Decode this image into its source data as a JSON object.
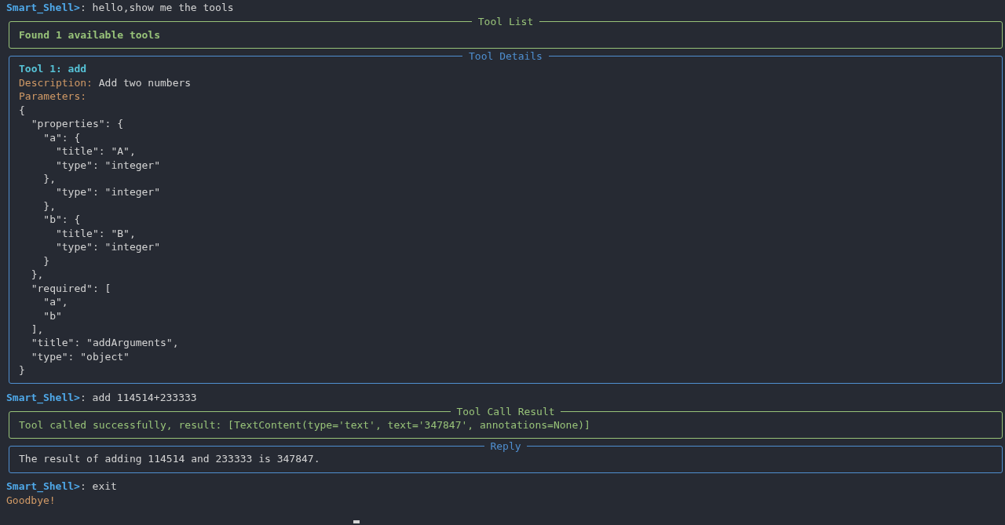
{
  "terminal": [
    {
      "kind": "prompt",
      "prompt": "Smart_Shell>",
      "separator": ":",
      "command": "hello,show me the tools"
    },
    {
      "kind": "panel",
      "title": "Tool List",
      "color": "#98c379",
      "lines": [
        {
          "kind": "success_bold",
          "text": "Found 1 available tools"
        }
      ]
    },
    {
      "kind": "panel",
      "title": "Tool Details",
      "color": "#4f8fd0",
      "lines": [
        {
          "kind": "heading",
          "text": "Tool 1: add"
        },
        {
          "kind": "field",
          "label": "Description:",
          "text": "Add two numbers"
        },
        {
          "kind": "label",
          "label": "Parameters:"
        },
        {
          "kind": "code",
          "text": "{"
        },
        {
          "kind": "code",
          "text": "  \"properties\": {"
        },
        {
          "kind": "code",
          "text": "    \"a\": {"
        },
        {
          "kind": "code",
          "text": "      \"title\": \"A\","
        },
        {
          "kind": "code",
          "text": "      \"type\": \"integer\""
        },
        {
          "kind": "code",
          "text": "    },"
        },
        {
          "kind": "code",
          "text": "      \"type\": \"integer\""
        },
        {
          "kind": "code",
          "text": "    },"
        },
        {
          "kind": "code",
          "text": "    \"b\": {"
        },
        {
          "kind": "code",
          "text": "      \"title\": \"B\","
        },
        {
          "kind": "code",
          "text": "      \"type\": \"integer\""
        },
        {
          "kind": "code",
          "text": "    }"
        },
        {
          "kind": "code",
          "text": "  },"
        },
        {
          "kind": "code",
          "text": "  \"required\": ["
        },
        {
          "kind": "code",
          "text": "    \"a\","
        },
        {
          "kind": "code",
          "text": "    \"b\""
        },
        {
          "kind": "code",
          "text": "  ],"
        },
        {
          "kind": "code",
          "text": "  \"title\": \"addArguments\","
        },
        {
          "kind": "code",
          "text": "  \"type\": \"object\""
        },
        {
          "kind": "code",
          "text": "}"
        }
      ]
    },
    {
      "kind": "prompt",
      "prompt": "Smart_Shell>",
      "separator": ":",
      "command": "add 114514+233333"
    },
    {
      "kind": "panel",
      "title": "Tool Call Result",
      "color": "#98c379",
      "lines": [
        {
          "kind": "success",
          "text": "Tool called successfully, result: [TextContent(type='text', text='347847', annotations=None)]"
        }
      ]
    },
    {
      "kind": "panel",
      "title": "Reply",
      "color": "#4f8fd0",
      "lines": [
        {
          "kind": "code",
          "text": "The result of adding 114514 and 233333 is 347847."
        }
      ]
    },
    {
      "kind": "prompt",
      "prompt": "Smart_Shell>",
      "separator": ":",
      "command": "exit"
    },
    {
      "kind": "message",
      "text": "Goodbye!"
    }
  ]
}
